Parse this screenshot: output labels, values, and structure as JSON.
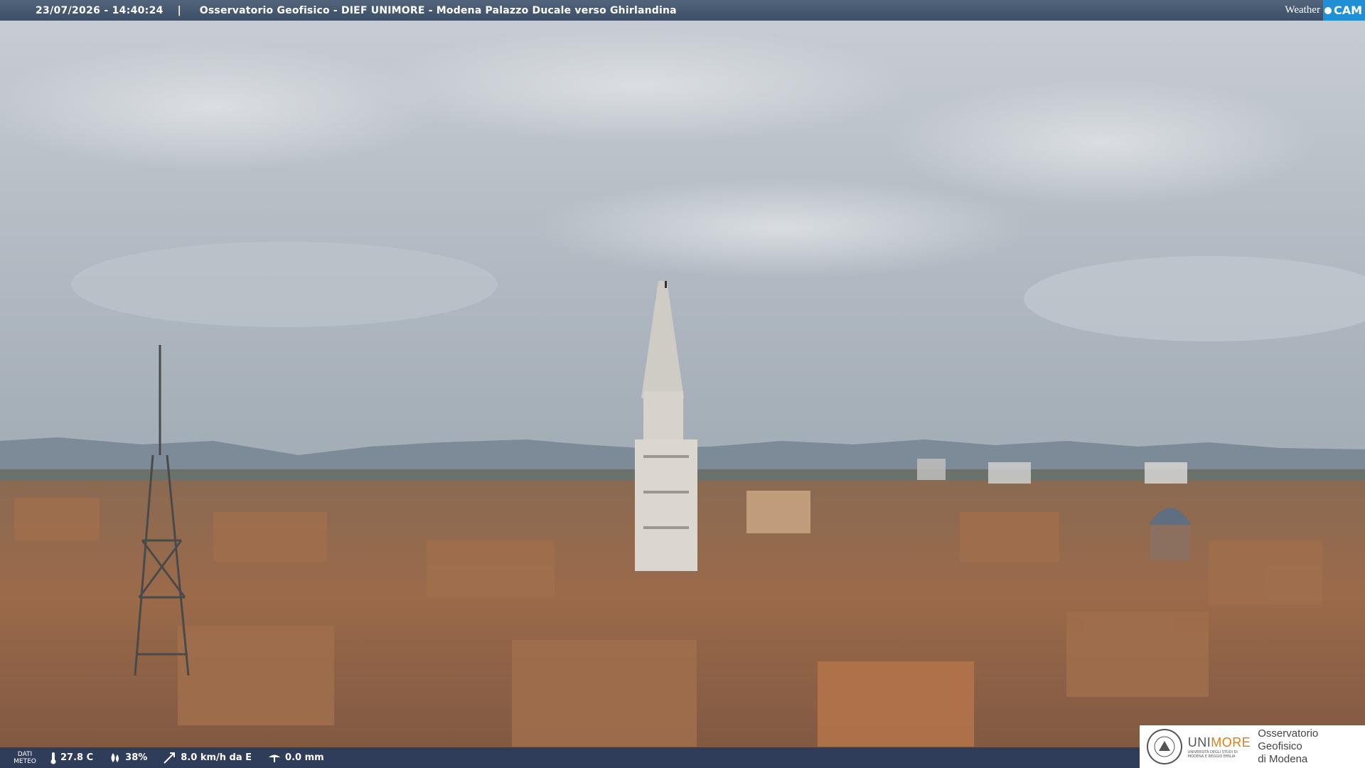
{
  "header": {
    "timestamp": "23/07/2026 - 14:40:24",
    "separator": "|",
    "title": "Osservatorio Geofisico - DIEF UNIMORE - Modena Palazzo Ducale verso Ghirlandina"
  },
  "brand": {
    "weather_label": "Weather",
    "cam_label": "CAM",
    "cam_color": "#1f8fd6"
  },
  "meteo": {
    "dati_label_1": "DATI",
    "dati_label_2": "METEO",
    "temperature": "27.8 C",
    "humidity": "38%",
    "wind": "8.0 km/h da E",
    "rain": "0.0 mm",
    "icons": [
      "thermometer-icon",
      "humidity-drop-icon",
      "wind-icon",
      "rain-gauge-icon"
    ]
  },
  "footer_logo": {
    "uni_name_part1": "UNI",
    "uni_name_part2": "MORE",
    "uni_subtitle_1": "UNIVERSITÀ DEGLI STUDI DI",
    "uni_subtitle_2": "MODENA E REGGIO EMILIA",
    "observatory_line1": "Osservatorio Geofisico",
    "observatory_line2": "di Modena",
    "accent_color": "#e07b12"
  }
}
